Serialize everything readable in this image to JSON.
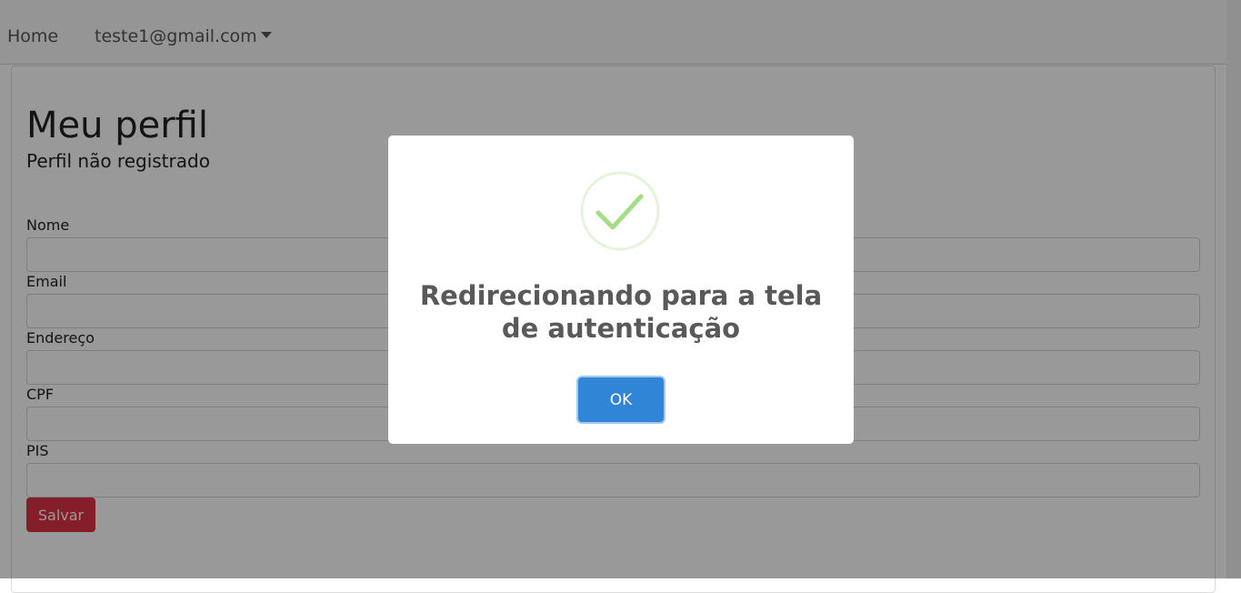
{
  "navbar": {
    "home_label": "Home",
    "user_label": "teste1@gmail.com"
  },
  "page": {
    "title": "Meu perfil",
    "subtitle": "Perfil não registrado"
  },
  "form": {
    "fields": [
      {
        "label": "Nome",
        "value": ""
      },
      {
        "label": "Email",
        "value": ""
      },
      {
        "label": "Endereço",
        "value": ""
      },
      {
        "label": "CPF",
        "value": ""
      },
      {
        "label": "PIS",
        "value": ""
      }
    ],
    "save_label": "Salvar"
  },
  "modal": {
    "title": "Redirecionando para a tela de autenticação",
    "ok_label": "OK",
    "icon": "success-check-icon"
  },
  "colors": {
    "danger": "#dc3545",
    "primary": "#3085d6",
    "success": "#a5dc86"
  }
}
